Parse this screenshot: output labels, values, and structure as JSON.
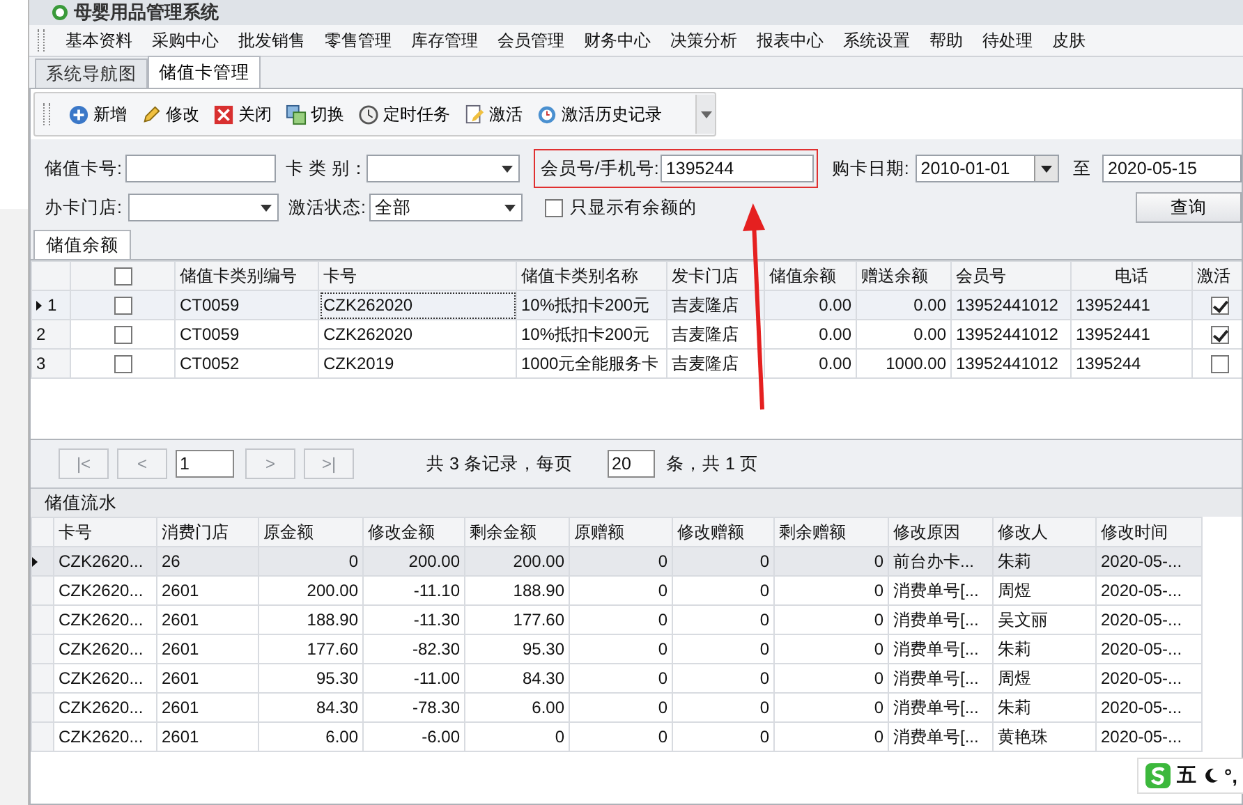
{
  "window": {
    "title": "母婴用品管理系统"
  },
  "menu": [
    "基本资料",
    "采购中心",
    "批发销售",
    "零售管理",
    "库存管理",
    "会员管理",
    "财务中心",
    "决策分析",
    "报表中心",
    "系统设置",
    "帮助",
    "待处理",
    "皮肤"
  ],
  "tabs": [
    {
      "label": "系统导航图",
      "selected": false
    },
    {
      "label": "储值卡管理",
      "selected": true
    }
  ],
  "toolbar": [
    {
      "label": "新增",
      "kind": "add"
    },
    {
      "label": "修改",
      "kind": "edit"
    },
    {
      "label": "关闭",
      "kind": "close"
    },
    {
      "label": "切换",
      "kind": "switch"
    },
    {
      "label": "定时任务",
      "kind": "timer"
    },
    {
      "label": "激活",
      "kind": "activate"
    },
    {
      "label": "激活历史记录",
      "kind": "history"
    }
  ],
  "filters": {
    "card_number": {
      "label": "储值卡号:"
    },
    "card_type": {
      "label": "卡 类 别："
    },
    "member": {
      "label": "会员号/手机号:",
      "value": "1395244",
      "highlighted": true
    },
    "purchase_from": {
      "label": "购卡日期:",
      "value": "2010-01-01"
    },
    "purchase_to": {
      "label": "至",
      "value": "2020-05-15"
    },
    "store": {
      "label": "办卡门店:"
    },
    "status": {
      "label": "激活状态:",
      "value": "全部"
    },
    "balance_only": {
      "label": "只显示有余额的",
      "checked": false
    },
    "query_button": "查询"
  },
  "balance_tab": "储值余额",
  "balance_table": {
    "all_checked": false,
    "columns": [
      "储值卡类别编号",
      "卡号",
      "储值卡类别名称",
      "发卡门店",
      "储值余额",
      "赠送余额",
      "会员号",
      "电话",
      "激活"
    ],
    "rows": [
      {
        "index": "1",
        "current": true,
        "checked": false,
        "type_code": "CT0059",
        "card": "CZK262020",
        "type_name": "10%抵扣卡200元",
        "store": "吉麦隆店",
        "balance": "0.00",
        "bonus": "0.00",
        "member": "13952441012",
        "phone": "13952441",
        "activated": true
      },
      {
        "index": "2",
        "current": false,
        "checked": false,
        "type_code": "CT0059",
        "card": "CZK262020",
        "type_name": "10%抵扣卡200元",
        "store": "吉麦隆店",
        "balance": "0.00",
        "bonus": "0.00",
        "member": "13952441012",
        "phone": "13952441",
        "activated": true
      },
      {
        "index": "3",
        "current": false,
        "checked": false,
        "type_code": "CT0052",
        "card": "CZK2019",
        "type_name": "1000元全能服务卡",
        "store": "吉麦隆店",
        "balance": "0.00",
        "bonus": "1000.00",
        "member": "13952441012",
        "phone": "1395244",
        "activated": false
      }
    ]
  },
  "pager": {
    "first": "|<",
    "prev": "<",
    "page": "1",
    "next": ">",
    "last": ">|",
    "summary": "共 3 条记录，每页",
    "page_size": "20",
    "pages": "条，共 1 页"
  },
  "flow_section": "储值流水",
  "flow_table": {
    "columns": [
      "卡号",
      "消费门店",
      "原金额",
      "修改金额",
      "剩余金额",
      "原赠额",
      "修改赠额",
      "剩余赠额",
      "修改原因",
      "修改人",
      "修改时间"
    ],
    "rows": [
      {
        "current": true,
        "cells": [
          "CZK2620...",
          "26",
          "0",
          "200.00",
          "200.00",
          "0",
          "0",
          "0",
          "前台办卡...",
          "朱莉",
          "2020-05-..."
        ]
      },
      {
        "current": false,
        "cells": [
          "CZK2620...",
          "2601",
          "200.00",
          "-11.10",
          "188.90",
          "0",
          "0",
          "0",
          "消费单号[...",
          "周煜",
          "2020-05-..."
        ]
      },
      {
        "current": false,
        "cells": [
          "CZK2620...",
          "2601",
          "188.90",
          "-11.30",
          "177.60",
          "0",
          "0",
          "0",
          "消费单号[...",
          "吴文丽",
          "2020-05-..."
        ]
      },
      {
        "current": false,
        "cells": [
          "CZK2620...",
          "2601",
          "177.60",
          "-82.30",
          "95.30",
          "0",
          "0",
          "0",
          "消费单号[...",
          "朱莉",
          "2020-05-..."
        ]
      },
      {
        "current": false,
        "cells": [
          "CZK2620...",
          "2601",
          "95.30",
          "-11.00",
          "84.30",
          "0",
          "0",
          "0",
          "消费单号[...",
          "周煜",
          "2020-05-..."
        ]
      },
      {
        "current": false,
        "cells": [
          "CZK2620...",
          "2601",
          "84.30",
          "-78.30",
          "6.00",
          "0",
          "0",
          "0",
          "消费单号[...",
          "朱莉",
          "2020-05-..."
        ]
      },
      {
        "current": false,
        "cells": [
          "CZK2620...",
          "2601",
          "6.00",
          "-6.00",
          "0",
          "0",
          "0",
          "0",
          "消费单号[...",
          "黄艳珠",
          "2020-05-..."
        ]
      }
    ]
  },
  "ime_bar": {
    "mode": "五",
    "punct": "°,"
  }
}
